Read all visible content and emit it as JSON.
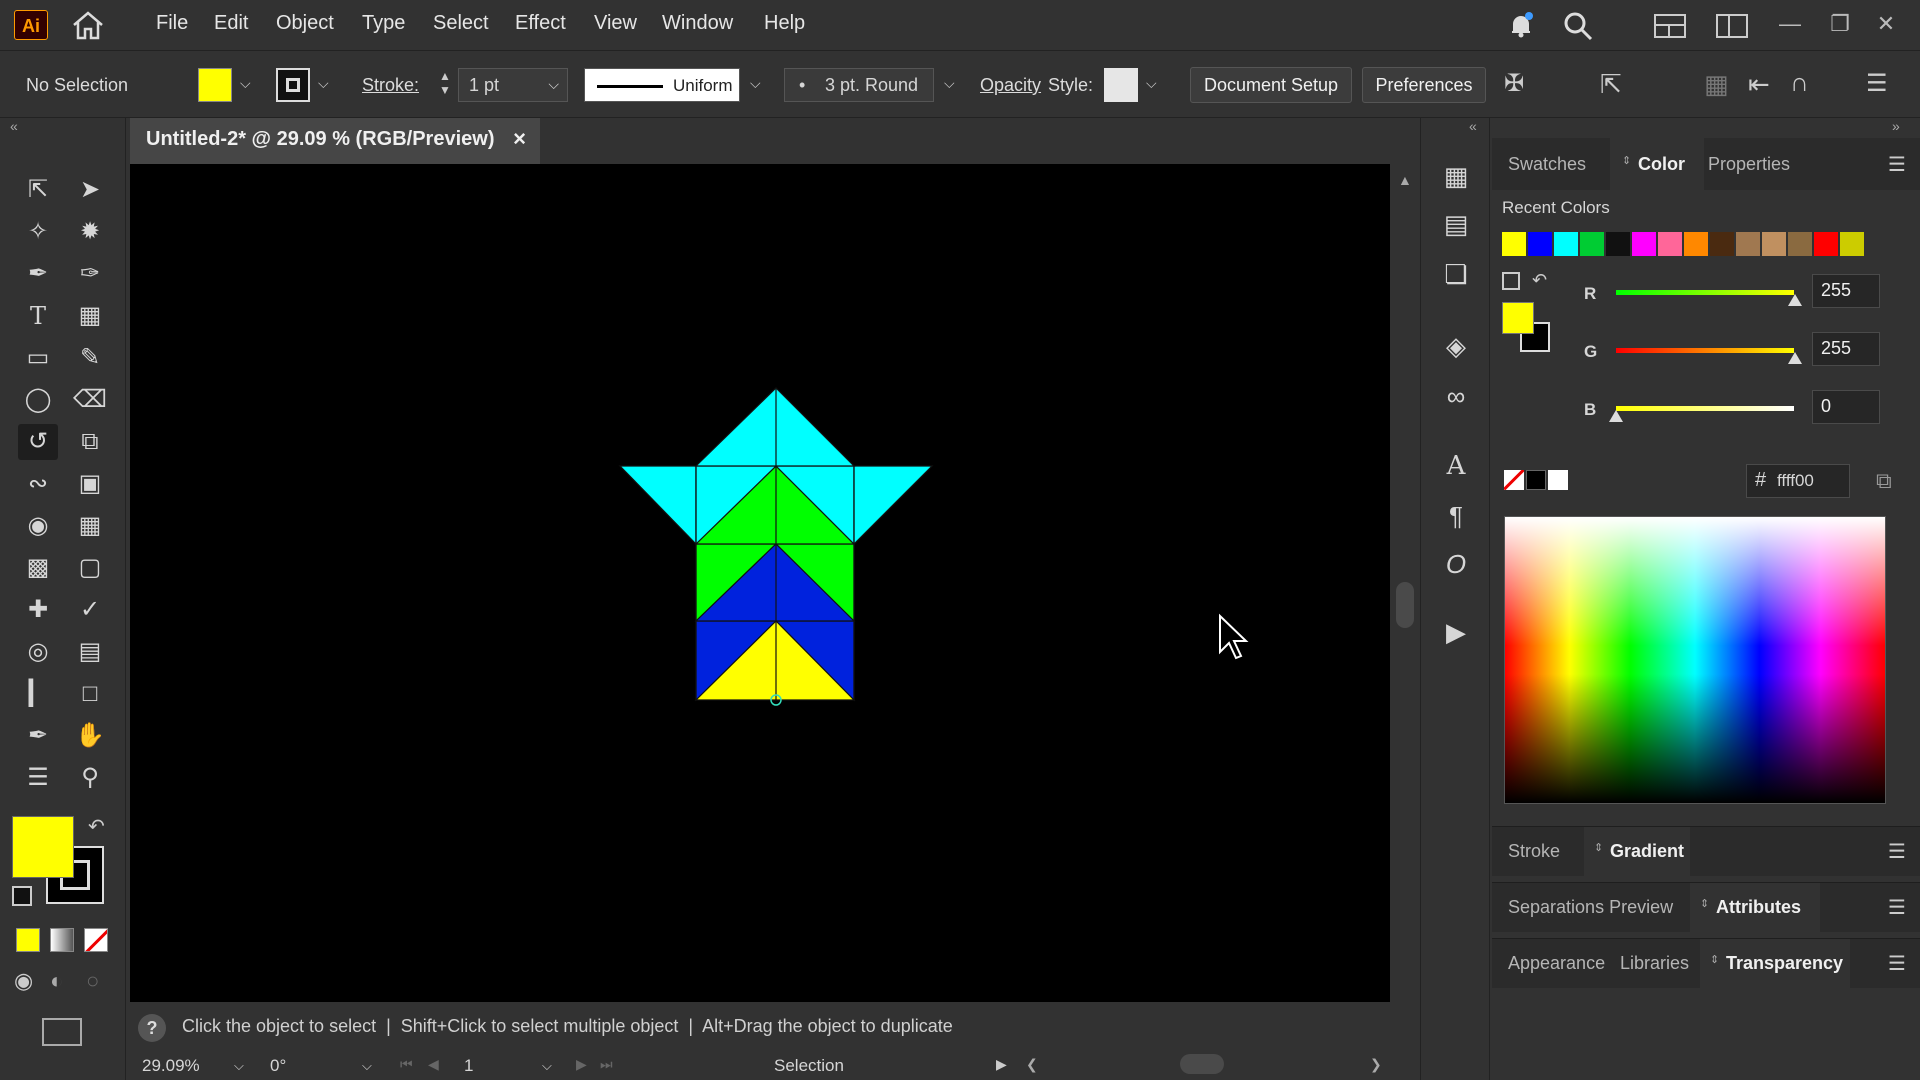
{
  "app": {
    "logo": "Ai"
  },
  "menu": [
    "File",
    "Edit",
    "Object",
    "Type",
    "Select",
    "Effect",
    "View",
    "Window",
    "Help"
  ],
  "control_bar": {
    "selection": "No Selection",
    "stroke_label": "Stroke:",
    "stroke_weight": "1 pt",
    "profile": "Uniform",
    "brush": "3 pt. Round",
    "opacity_label": "Opacity",
    "style_label": "Style:",
    "document_setup": "Document Setup",
    "preferences": "Preferences"
  },
  "document_tab": {
    "title": "Untitled-2* @ 29.09 % (RGB/Preview)",
    "close": "×"
  },
  "status": {
    "hint": "Click the object to select  |  Shift+Click to select multiple object  |  Alt+Drag the object to duplicate",
    "zoom": "29.09%",
    "rotation": "0°",
    "artboard": "1",
    "mode": "Selection"
  },
  "panel_tabs": [
    "Swatches",
    "Color",
    "Properties"
  ],
  "color_panel": {
    "recent_label": "Recent Colors",
    "recent_colors": [
      "#ffff00",
      "#0000ff",
      "#00ffff",
      "#00cc33",
      "#111111",
      "#ff00ff",
      "#ff6699",
      "#ff8800",
      "#4a2a10",
      "#a07850",
      "#c09060",
      "#8a6a40",
      "#ff0000",
      "#cccc00"
    ],
    "r_label": "R",
    "r_value": "255",
    "g_label": "G",
    "g_value": "255",
    "b_label": "B",
    "b_value": "0",
    "hex_symbol": "#",
    "hex": "ffff00"
  },
  "lower_panels": {
    "stroke": "Stroke",
    "gradient": "Gradient",
    "separations": "Separations Preview",
    "attributes": "Attributes",
    "appearance": "Appearance",
    "libraries": "Libraries",
    "transparency": "Transparency"
  },
  "colors": {
    "fill": "#ffff00",
    "accent_cyan": "#00ffff",
    "accent_green": "#00ff00",
    "accent_blue": "#0022dd"
  }
}
